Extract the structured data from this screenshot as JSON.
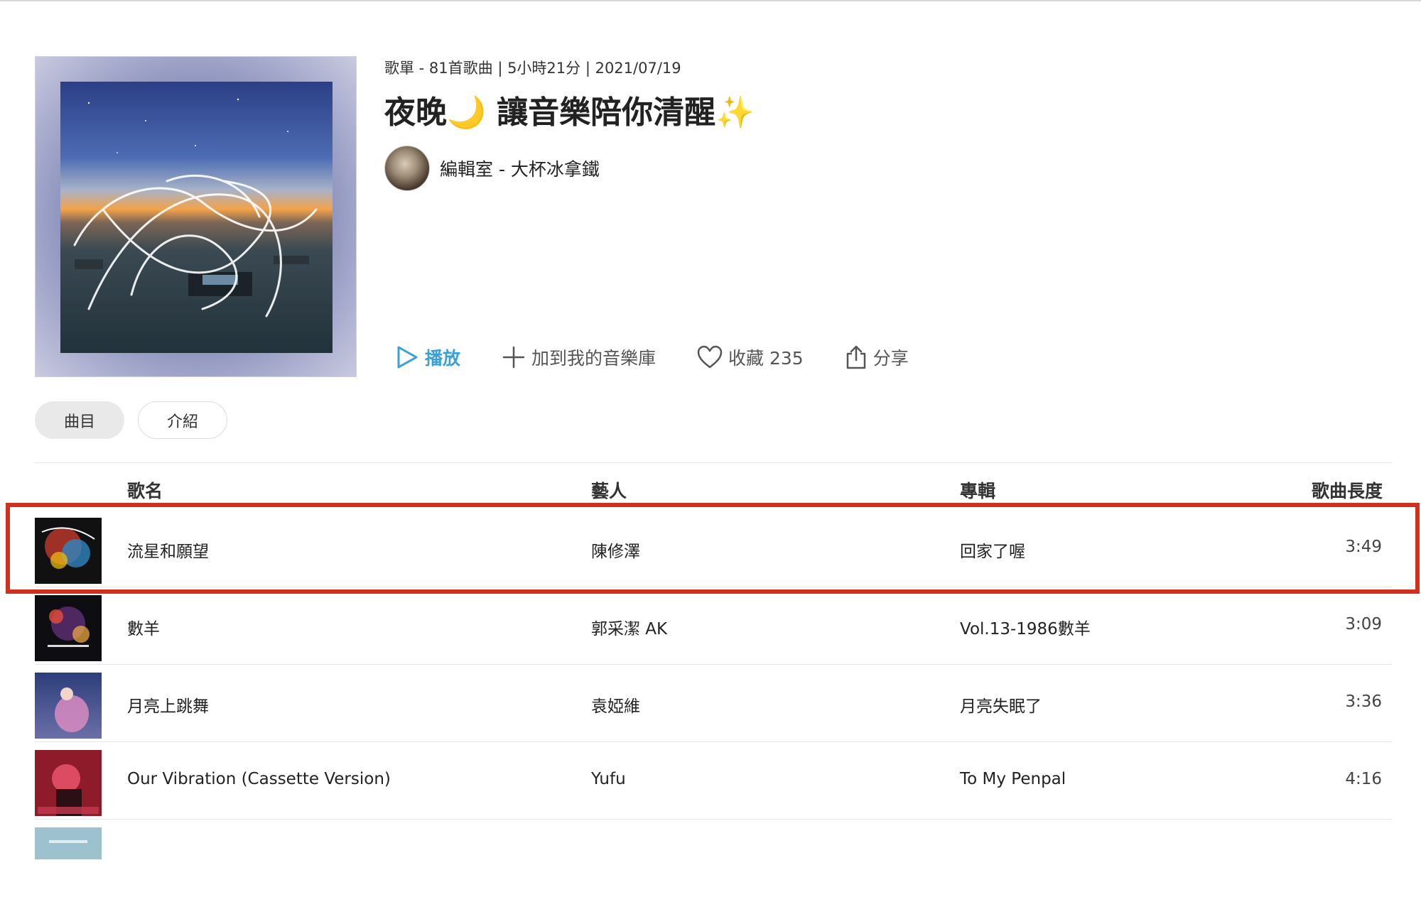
{
  "header": {
    "meta": "歌單 - 81首歌曲 | 5小時21分 | 2021/07/19",
    "title": "夜晚🌙 讓音樂陪你清醒✨",
    "curator": "編輯室 - 大杯冰拿鐵"
  },
  "actions": {
    "play": "播放",
    "add_library": "加到我的音樂庫",
    "favorite": "收藏 235",
    "share": "分享"
  },
  "tabs": [
    "曲目",
    "介紹"
  ],
  "columns": {
    "title": "歌名",
    "artist": "藝人",
    "album": "專輯",
    "duration": "歌曲長度"
  },
  "tracks": [
    {
      "title": "流星和願望",
      "artist": "陳修澤",
      "album": "回家了喔",
      "duration": "3:49"
    },
    {
      "title": "數羊",
      "artist": "郭采潔 AK",
      "album": "Vol.13-1986數羊",
      "duration": "3:09"
    },
    {
      "title": "月亮上跳舞",
      "artist": "袁婭維",
      "album": "月亮失眠了",
      "duration": "3:36"
    },
    {
      "title": "Our Vibration (Cassette Version)",
      "artist": "Yufu",
      "album": "To My Penpal",
      "duration": "4:16"
    }
  ],
  "colors": {
    "accent_play": "#3ba0d8",
    "highlight_border": "#d0311f",
    "tab_active_bg": "#e9e9e9"
  },
  "icons": {
    "play": "play-triangle-icon",
    "add": "plus-icon",
    "favorite": "heart-outline-icon",
    "share": "share-box-arrow-icon"
  }
}
